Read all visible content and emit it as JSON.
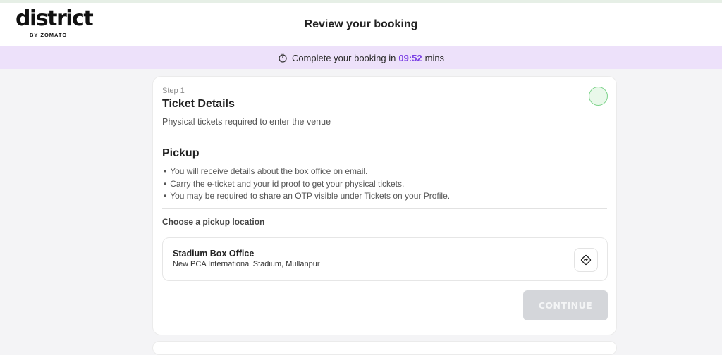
{
  "brand": {
    "logo_text": "district",
    "logo_subtext": "BY ZOMATO"
  },
  "header": {
    "title": "Review your booking"
  },
  "timer": {
    "prefix": "Complete your booking in",
    "time": "09:52",
    "suffix": "mins",
    "icon": "stopwatch-icon",
    "accent_color": "#7b3fe4"
  },
  "step": {
    "label": "Step 1",
    "title": "Ticket Details",
    "subtitle": "Physical tickets required to enter the venue",
    "status_icon": "status-circle-icon"
  },
  "pickup": {
    "title": "Pickup",
    "bullets": [
      "You will receive details about the box office on email.",
      "Carry the e-ticket and your id proof to get your physical tickets.",
      "You may be required to share an OTP visible under Tickets on your Profile."
    ],
    "choose_label": "Choose a pickup location",
    "location": {
      "name": "Stadium Box Office",
      "address": "New PCA International Stadium, Mullanpur",
      "icon": "directions-icon"
    }
  },
  "actions": {
    "continue_label": "CONTINUE"
  },
  "colors": {
    "timer_bg": "#ede1fa",
    "button_disabled": "#d4d6da",
    "status_green": "#7cd38a"
  }
}
